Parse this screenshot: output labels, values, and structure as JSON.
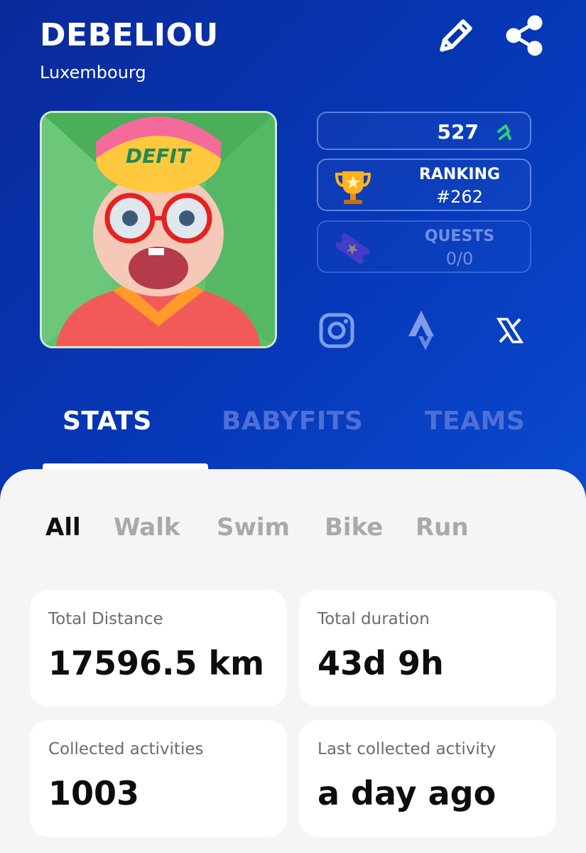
{
  "profile": {
    "username": "DEBELIOU",
    "country": "Luxembourg",
    "points": "527",
    "ranking_label": "RANKING",
    "ranking_value": "#262",
    "quests_label": "QUESTS",
    "quests_value": "0/0",
    "avatar_text": "DEFIT"
  },
  "icons": {
    "edit": "pencil-icon",
    "share": "share-icon",
    "points": "up-arrows-icon",
    "ranking": "trophy-icon",
    "quests": "ticket-icon",
    "social": [
      "instagram-icon",
      "strava-icon",
      "x-icon"
    ]
  },
  "tabs": [
    {
      "label": "STATS",
      "active": true
    },
    {
      "label": "BABYFITS",
      "active": false
    },
    {
      "label": "TEAMS",
      "active": false
    }
  ],
  "filters": [
    {
      "label": "All",
      "active": true
    },
    {
      "label": "Walk",
      "active": false
    },
    {
      "label": "Swim",
      "active": false
    },
    {
      "label": "Bike",
      "active": false
    },
    {
      "label": "Run",
      "active": false
    }
  ],
  "stats": [
    {
      "label": "Total Distance",
      "value": "17596.5 km"
    },
    {
      "label": "Total duration",
      "value": "43d 9h"
    },
    {
      "label": "Collected activities",
      "value": "1003"
    },
    {
      "label": "Last collected activity",
      "value": "a day ago"
    }
  ],
  "colors": {
    "header_start": "#0a2a9a",
    "header_end": "#0a4ad0",
    "inactive_tab": "#4f6fd8",
    "accent_green": "#2ecf7a",
    "panel_bg": "#f5f5f7"
  }
}
